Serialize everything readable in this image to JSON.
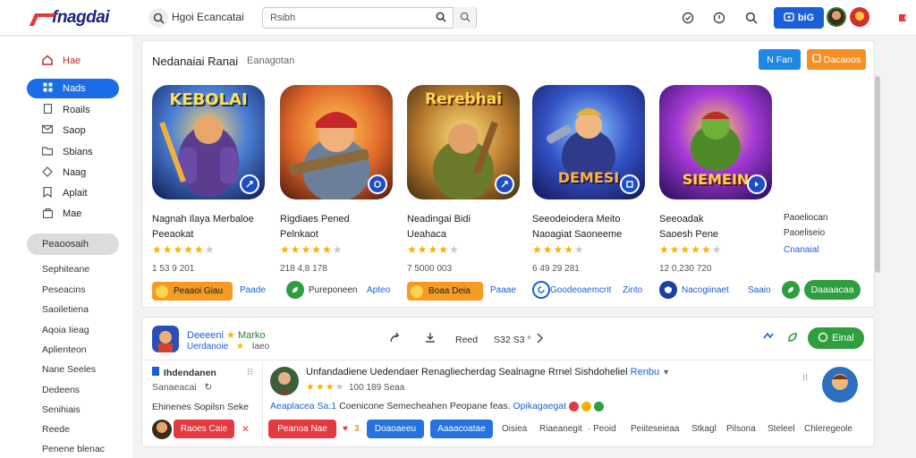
{
  "header": {
    "logo_text": "fnagdai",
    "title": "Hgoi Ecancatai",
    "search_value": "Rsibh",
    "channel_button": "biG",
    "icons": [
      "search-icon",
      "globe-icon",
      "help-icon",
      "search-icon",
      "notification-icon"
    ]
  },
  "sidebar": {
    "items": [
      {
        "label": "Hae",
        "icon": "home-icon"
      },
      {
        "label": "Nads",
        "icon": "grid-icon"
      },
      {
        "label": "Roails",
        "icon": "book-icon"
      },
      {
        "label": "Saop",
        "icon": "mail-icon"
      },
      {
        "label": "Sbians",
        "icon": "folder-icon"
      },
      {
        "label": "Naag",
        "icon": "tag-icon"
      },
      {
        "label": "Aplait",
        "icon": "bookmark-icon"
      },
      {
        "label": "Mae",
        "icon": "bag-icon"
      }
    ],
    "section_label": "Peaoosaih",
    "links": [
      "Sephiteane",
      "Peseacins",
      "Saoiletiena",
      "Aqoia Iieag",
      "Aplienteon",
      "Nane Seeles",
      "Dedeens",
      "Senihiais",
      "Reede",
      "Penene blenac"
    ]
  },
  "featured": {
    "title": "Nedanaiai Ranai",
    "subtitle": "Eanagotan",
    "button_small": "N Fan",
    "button_orange": "Dacaoos",
    "games": [
      {
        "art_word": "KEBOLAI",
        "name1": "Nagnah Ilaya Merbaloe",
        "name2": "Peeaokat",
        "stars": 4.5,
        "count": "1 53 9 201",
        "pill": "Peaaoi Giau",
        "link": "Paade"
      },
      {
        "art_word": "",
        "name1": "Rigdiaes Pened",
        "name2": "Pelnkaot",
        "stars": 4.5,
        "count": "218 4,8 178",
        "pill": "Pureponeen",
        "link": "Apteo"
      },
      {
        "art_word": "Rerebhai",
        "name1": "Neadingai Bidi",
        "name2": "Ueahaca",
        "stars": 4.0,
        "count": "7 5000 003",
        "pill": "Boaa Deia",
        "link": "Paaae"
      },
      {
        "art_word": "DEMESI",
        "name1": "Seeodeiodera Meito",
        "name2": "Naoagiat Saoneeme",
        "stars": 4.0,
        "count": "6 49 29 281",
        "pill": "Goodeoaemcrit",
        "link": "Zinto"
      },
      {
        "art_word": "SIEMEIN",
        "name1": "Seeoadak",
        "name2": "Saoesh Pene",
        "stars": 4.5,
        "count": "12 0,230 720",
        "pill": "Nacogiinaet",
        "link": "Saaio"
      }
    ],
    "side_col": [
      "Paoeliocan",
      "Paoeliseio",
      "Cnanaial"
    ],
    "side_button": "Daaaacaa"
  },
  "detail": {
    "title_prefix": "Deeeeni",
    "title_name": "Marko",
    "subtitle_a": "Uerdanoie",
    "subtitle_b": "Iaeo",
    "stat_label": "Reed",
    "stat_value": "S32 S3 °",
    "install_button": "Einal",
    "left_title": "Ihdendanen",
    "left_sub": "Sanaeacai",
    "left_sub2": "Ehinenes Sopilsn Seke",
    "comment_head": "Unfandadiene Uedendaer Renagliecherdag Sealnagne Rrnel Sishdoheliel",
    "comment_head_link": "Renbu",
    "comment_date": "100 189 Seaa",
    "comment_link": "Aeaplacea Sa:1",
    "comment_text": "Coenicone Semecheahen Peopane feas.",
    "comment_link2": "Opikagaegat",
    "pill_red1": "Raoes Caie",
    "pill_red2": "Peanoa Nae",
    "count_small": "3",
    "pill_blue1": "Doaoaeeu",
    "pill_blue2": "Aaaacoatae",
    "tags": [
      "Oisiea",
      "Riaeanegit",
      "· Peoid",
      "Peiiteseieaa",
      "Stkagl",
      "Pilsona",
      "Steleel",
      "Chleregeole"
    ]
  },
  "colors": {
    "accent_blue": "#1a6ce8",
    "orange": "#f59123",
    "green": "#2e9e3e",
    "red": "#e53940",
    "star": "#f5b301"
  }
}
